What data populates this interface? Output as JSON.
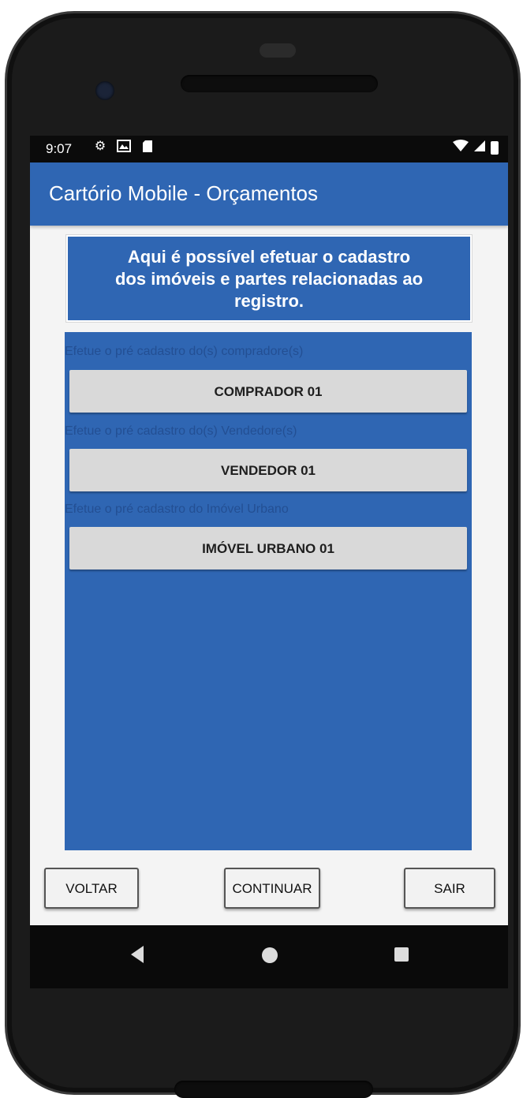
{
  "status_bar": {
    "time": "9:07",
    "left_icons": [
      "settings-icon",
      "image-notification-icon",
      "sd-card-icon"
    ],
    "right_icons": [
      "wifi-icon",
      "signal-icon",
      "battery-icon"
    ]
  },
  "app_bar": {
    "title": "Cartório Mobile - Orçamentos"
  },
  "info": {
    "line1": "Aqui é possível efetuar o cadastro",
    "line2": "dos imóveis e partes relacionadas ao",
    "line3": "registro."
  },
  "sections": [
    {
      "label": "Efetue o pré cadastro do(s) compradore(s)",
      "button": "COMPRADOR 01"
    },
    {
      "label": "Efetue o pré cadastro do(s) Vendedore(s)",
      "button": "VENDEDOR 01"
    },
    {
      "label": "Efetue o pré cadastro do Imóvel Urbano",
      "button": "IMÓVEL URBANO 01"
    }
  ],
  "actions": {
    "back": "VOLTAR",
    "continue": "CONTINUAR",
    "exit": "SAIR"
  },
  "colors": {
    "primary": "#2f66b3",
    "section_label": "#234f93",
    "item_button": "#d9d9d9"
  }
}
